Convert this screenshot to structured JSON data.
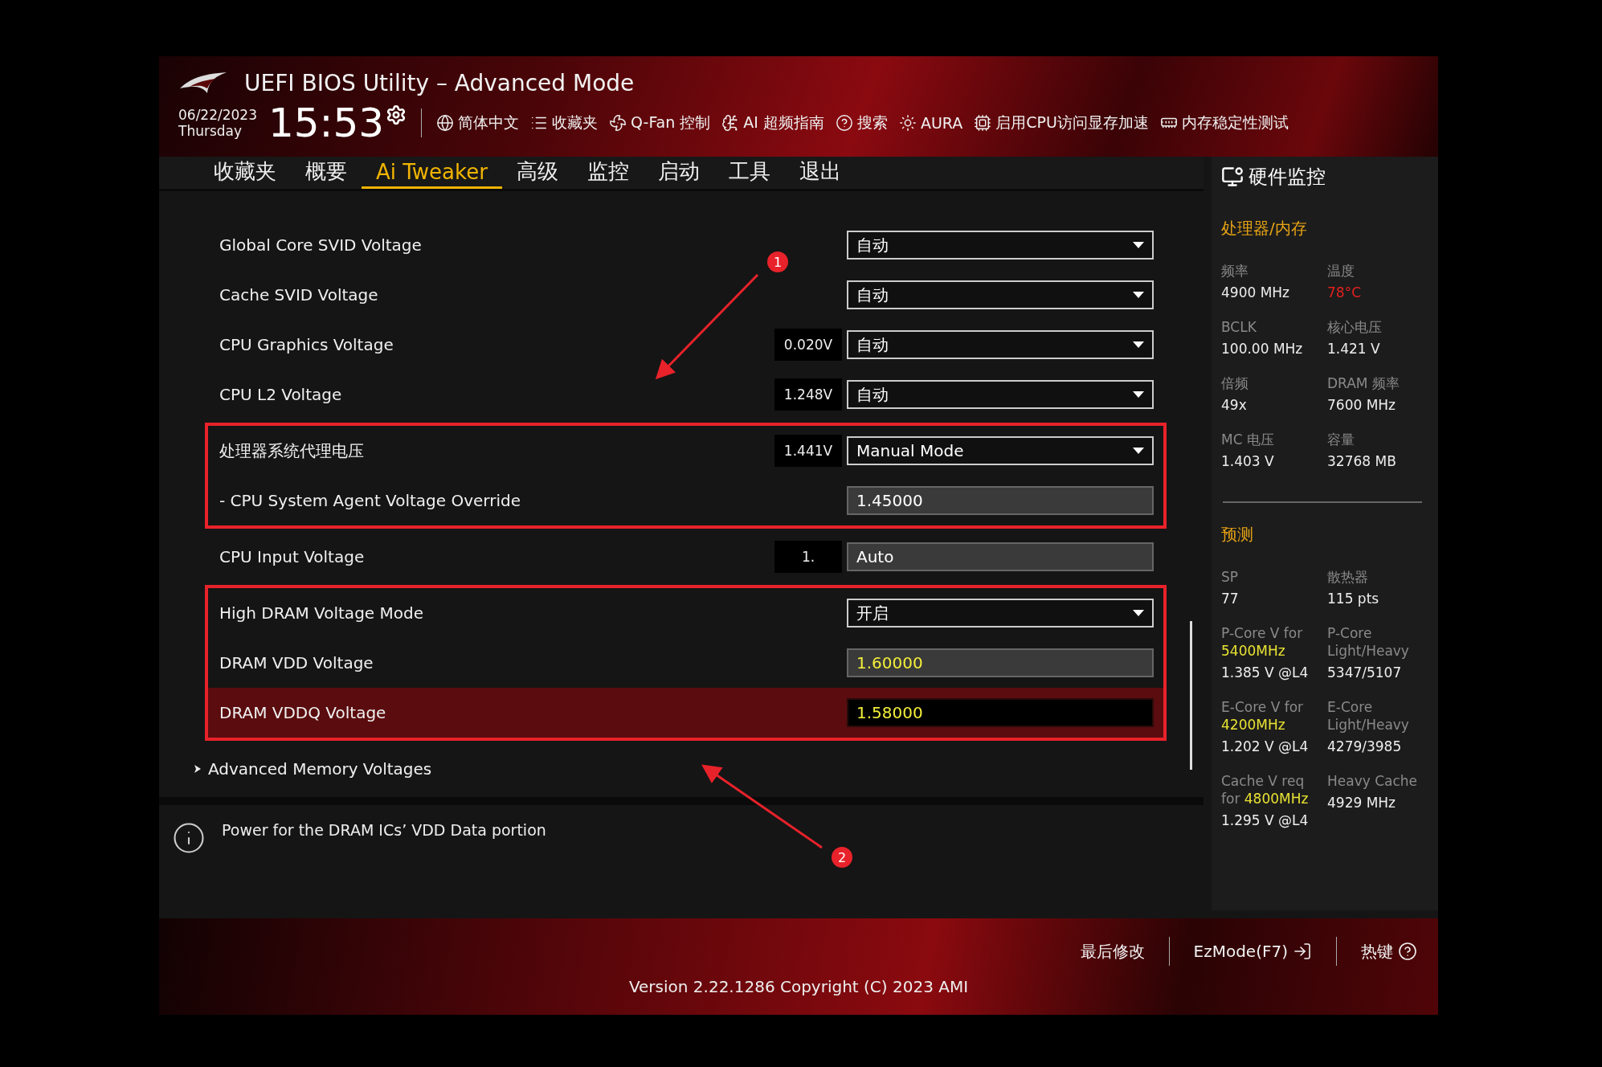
{
  "window": {
    "title": "UEFI BIOS Utility – Advanced Mode"
  },
  "clock": {
    "date": "06/22/2023",
    "weekday": "Thursday",
    "time": "15:53"
  },
  "toolbar": [
    {
      "label": "简体中文"
    },
    {
      "label": "收藏夹"
    },
    {
      "label": "Q-Fan 控制"
    },
    {
      "label": "AI 超频指南"
    },
    {
      "label": "搜索"
    },
    {
      "label": "AURA"
    },
    {
      "label": "启用CPU访问显存加速"
    },
    {
      "label": "内存稳定性测试"
    }
  ],
  "tabs": [
    {
      "label": "收藏夹",
      "selected": false
    },
    {
      "label": "概要",
      "selected": false
    },
    {
      "label": "Ai Tweaker",
      "selected": true
    },
    {
      "label": "高级",
      "selected": false
    },
    {
      "label": "监控",
      "selected": false
    },
    {
      "label": "启动",
      "selected": false
    },
    {
      "label": "工具",
      "selected": false
    },
    {
      "label": "退出",
      "selected": false
    }
  ],
  "settings": [
    {
      "outlined": false,
      "rows": [
        {
          "label": "Global Core SVID Voltage",
          "kind": "select",
          "value": "自动",
          "selected": false,
          "changed": false
        },
        {
          "label": "Cache SVID Voltage",
          "kind": "select",
          "value": "自动",
          "selected": false,
          "changed": false
        },
        {
          "label": "CPU Graphics Voltage",
          "reading": "0.020V",
          "kind": "select",
          "value": "自动",
          "selected": false,
          "changed": false
        },
        {
          "label": "CPU L2 Voltage",
          "reading": "1.248V",
          "kind": "select",
          "value": "自动",
          "selected": false,
          "changed": false
        }
      ]
    },
    {
      "outlined": true,
      "rows": [
        {
          "label": "处理器系统代理电压",
          "reading": "1.441V",
          "kind": "select",
          "value": "Manual Mode",
          "selected": false,
          "changed": false
        },
        {
          "label": "- CPU System Agent Voltage Override",
          "kind": "field",
          "value": "1.45000",
          "selected": false,
          "changed": false
        }
      ]
    },
    {
      "outlined": false,
      "rows": [
        {
          "label": "CPU Input Voltage",
          "reading": "1.",
          "kind": "field",
          "value": "Auto",
          "selected": false,
          "changed": false
        }
      ]
    },
    {
      "outlined": true,
      "rows": [
        {
          "label": "High DRAM Voltage Mode",
          "kind": "select",
          "value": "开启",
          "selected": false,
          "changed": false
        },
        {
          "label": "DRAM VDD Voltage",
          "kind": "field",
          "value": "1.60000",
          "selected": false,
          "changed": true
        },
        {
          "label": "DRAM VDDQ Voltage",
          "kind": "field",
          "value": "1.58000",
          "selected": true,
          "changed": true
        }
      ]
    },
    {
      "outlined": false,
      "rows": [
        {
          "label": "Advanced Memory Voltages",
          "kind": "submenu"
        }
      ]
    }
  ],
  "help": {
    "text": "Power for the DRAM ICs’ VDD Data portion"
  },
  "annotations": [
    {
      "label": "1"
    },
    {
      "label": "2"
    }
  ],
  "monitor": {
    "title": "硬件监控",
    "sections": [
      {
        "title": "处理器/内存",
        "items": [
          {
            "label": "频率",
            "value": "4900 MHz",
            "alert": false
          },
          {
            "label": "温度",
            "value": "78°C",
            "alert": true
          },
          {
            "label": "BCLK",
            "value": "100.00 MHz",
            "alert": false
          },
          {
            "label": "核心电压",
            "value": "1.421 V",
            "alert": false
          },
          {
            "label": "倍频",
            "value": "49x",
            "alert": false
          },
          {
            "label": "DRAM 频率",
            "value": "7600 MHz",
            "alert": false
          },
          {
            "label": "MC 电压",
            "value": "1.403 V",
            "alert": false
          },
          {
            "label": "容量",
            "value": "32768 MB",
            "alert": false
          }
        ]
      },
      {
        "title": "预测",
        "items": [
          {
            "label": "SP",
            "value": "77",
            "alert": false
          },
          {
            "label": "散热器",
            "value": "115 pts",
            "alert": false
          },
          {
            "label": "P-Core V for",
            "highlight": "5400MHz",
            "value": "1.385 V @L4",
            "alert": false
          },
          {
            "label": "P-Core Light/Heavy",
            "value": "5347/5107",
            "alert": false
          },
          {
            "label": "E-Core V for",
            "highlight": "4200MHz",
            "value": "1.202 V @L4",
            "alert": false
          },
          {
            "label": "E-Core Light/Heavy",
            "value": "4279/3985",
            "alert": false
          },
          {
            "label": "Cache V req for",
            "highlight": "4800MHz",
            "value": "1.295 V @L4",
            "alert": false
          },
          {
            "label": "Heavy Cache",
            "value": "4929 MHz",
            "alert": false
          }
        ]
      }
    ]
  },
  "footer": {
    "actions": [
      {
        "label": "最后修改"
      },
      {
        "label": "EzMode(F7)"
      },
      {
        "label": "热键"
      }
    ],
    "version": "Version 2.22.1286 Copyright (C) 2023 AMI"
  }
}
